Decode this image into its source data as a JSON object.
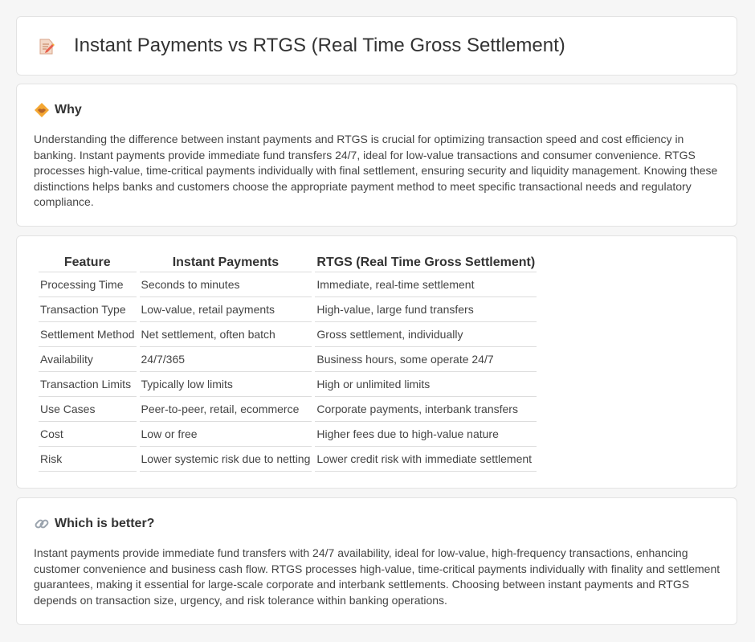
{
  "header": {
    "title": "Instant Payments vs RTGS (Real Time Gross Settlement)",
    "icon": "document-pencil-icon"
  },
  "why": {
    "icon": "handshake-icon",
    "title": "Why",
    "text": "Understanding the difference between instant payments and RTGS is crucial for optimizing transaction speed and cost efficiency in banking. Instant payments provide immediate fund transfers 24/7, ideal for low-value transactions and consumer convenience. RTGS processes high-value, time-critical payments individually with final settlement, ensuring security and liquidity management. Knowing these distinctions helps banks and customers choose the appropriate payment method to meet specific transactional needs and regulatory compliance."
  },
  "table": {
    "headers": [
      "Feature",
      "Instant Payments",
      "RTGS (Real Time Gross Settlement)"
    ],
    "rows": [
      [
        "Processing Time",
        "Seconds to minutes",
        "Immediate, real-time settlement"
      ],
      [
        "Transaction Type",
        "Low-value, retail payments",
        "High-value, large fund transfers"
      ],
      [
        "Settlement Method",
        "Net settlement, often batch",
        "Gross settlement, individually"
      ],
      [
        "Availability",
        "24/7/365",
        "Business hours, some operate 24/7"
      ],
      [
        "Transaction Limits",
        "Typically low limits",
        "High or unlimited limits"
      ],
      [
        "Use Cases",
        "Peer-to-peer, retail, ecommerce",
        "Corporate payments, interbank transfers"
      ],
      [
        "Cost",
        "Low or free",
        "Higher fees due to high-value nature"
      ],
      [
        "Risk",
        "Lower systemic risk due to netting",
        "Lower credit risk with immediate settlement"
      ]
    ]
  },
  "better": {
    "icon": "link-icon",
    "title": "Which is better?",
    "text": "Instant payments provide immediate fund transfers with 24/7 availability, ideal for low-value, high-frequency transactions, enhancing customer convenience and business cash flow. RTGS processes high-value, time-critical payments individually with finality and settlement guarantees, making it essential for large-scale corporate and interbank settlements. Choosing between instant payments and RTGS depends on transaction size, urgency, and risk tolerance within banking operations."
  }
}
